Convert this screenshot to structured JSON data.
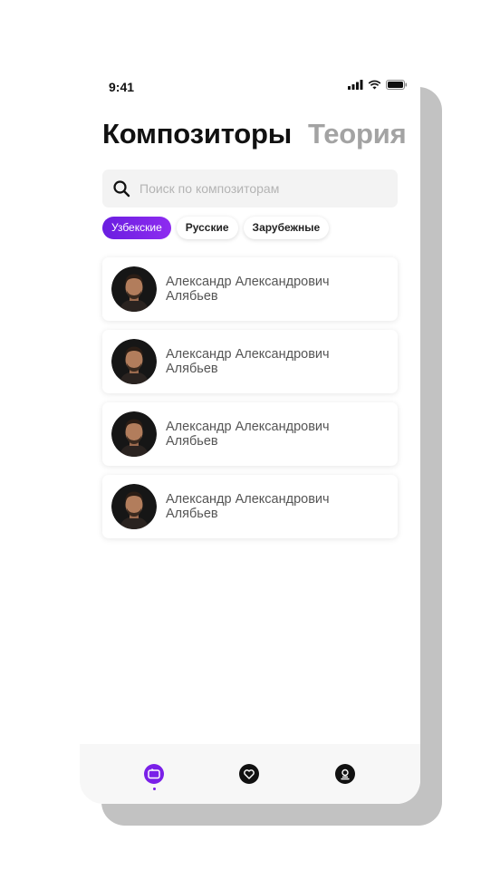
{
  "status_bar": {
    "time": "9:41"
  },
  "tabs": [
    {
      "label": "Композиторы",
      "active": true
    },
    {
      "label": "Теория",
      "active": false
    }
  ],
  "search": {
    "placeholder": "Поиск по композиторам",
    "value": ""
  },
  "filters": [
    {
      "label": "Узбекские",
      "active": true
    },
    {
      "label": "Русские",
      "active": false
    },
    {
      "label": "Зарубежные",
      "active": false
    }
  ],
  "composers": [
    {
      "first_line": "Александр Александрович",
      "second_line": "Алябьев"
    },
    {
      "first_line": "Александр Александрович",
      "second_line": "Алябьев"
    },
    {
      "first_line": "Александр Александрович",
      "second_line": "Алябьев"
    },
    {
      "first_line": "Александр Александрович",
      "second_line": "Алябьев"
    }
  ],
  "bottom_nav": [
    {
      "icon": "tv-icon",
      "active": true
    },
    {
      "icon": "heart-icon",
      "active": false
    },
    {
      "icon": "profile-icon",
      "active": false
    }
  ],
  "colors": {
    "accent": "#7a20e8",
    "inactive_tab": "#a3a3a3",
    "nav_background": "#f7f7f7"
  }
}
